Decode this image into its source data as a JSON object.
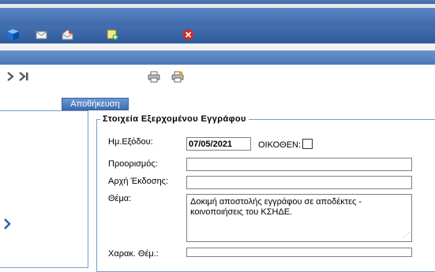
{
  "toolbar": {
    "icons": [
      "cube-icon",
      "mail-icon",
      "mail-open-icon",
      "note-add-icon",
      "close-icon"
    ]
  },
  "nav": {
    "next_icon": "chevron-right-icon",
    "last_icon": "chevron-last-icon",
    "expand_icon": "chevron-right-icon"
  },
  "actions": {
    "save_label": "Αποθήκευση"
  },
  "form": {
    "legend": "Στοιχεία Εξερχομένου Εγγράφου",
    "exit_date_label": "Ημ.Εξόδου:",
    "exit_date_value": "07/05/2021",
    "okothen_label": "ΟΙΚΟΘΕΝ:",
    "destination_label": "Προορισμός:",
    "destination_value": "",
    "issuing_authority_label": "Αρχή Έκδοσης:",
    "issuing_authority_value": "",
    "subject_label": "Θέμα:",
    "subject_value": "Δοκιμή αποστολής εγγράφου σε αποδέκτες - κοινοποιήσεις του ΚΣΗΔΕ.",
    "subject_char_label": "Χαρακ. Θέμ.:"
  }
}
